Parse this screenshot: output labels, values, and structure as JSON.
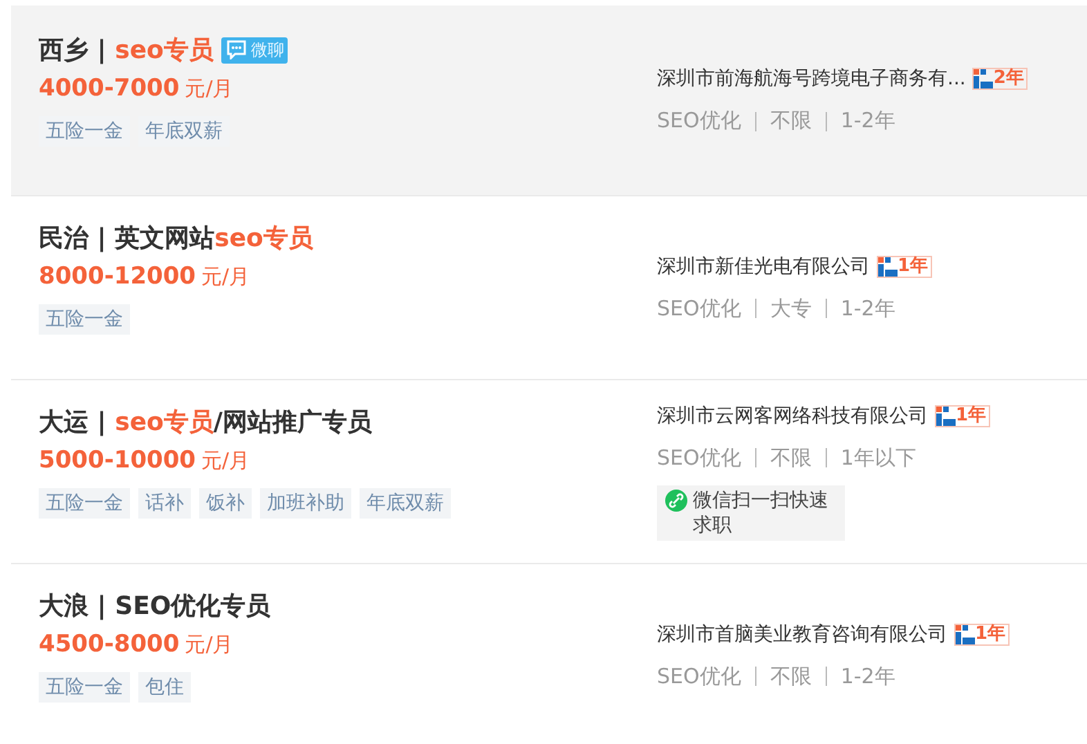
{
  "jobs": [
    {
      "selected": true,
      "title": [
        {
          "text": "西乡 | ",
          "highlight": false
        },
        {
          "text": "seo专员",
          "highlight": true
        }
      ],
      "chat_badge": "微聊",
      "salary": "4000-7000",
      "salary_unit": "元/月",
      "tags": [
        "五险一金",
        "年底双薪"
      ],
      "company": "深圳市前海航海号跨境电子商务有...",
      "member_years": "2年",
      "meta": [
        "SEO优化",
        "不限",
        "1-2年"
      ]
    },
    {
      "selected": false,
      "title": [
        {
          "text": "民治 | 英文网站",
          "highlight": false
        },
        {
          "text": "seo专员",
          "highlight": true
        }
      ],
      "salary": "8000-12000",
      "salary_unit": "元/月",
      "tags": [
        "五险一金"
      ],
      "company": "深圳市新佳光电有限公司",
      "member_years": "1年",
      "meta": [
        "SEO优化",
        "大专",
        "1-2年"
      ]
    },
    {
      "selected": false,
      "title": [
        {
          "text": "大运 | ",
          "highlight": false
        },
        {
          "text": "seo专员",
          "highlight": true
        },
        {
          "text": "/网站推广专员",
          "highlight": false
        }
      ],
      "salary": "5000-10000",
      "salary_unit": "元/月",
      "tags": [
        "五险一金",
        "话补",
        "饭补",
        "加班补助",
        "年底双薪"
      ],
      "company": "深圳市云网客网络科技有限公司",
      "member_years": "1年",
      "meta": [
        "SEO优化",
        "不限",
        "1年以下"
      ],
      "wechat_apply": "微信扫一扫快速求职"
    },
    {
      "selected": false,
      "title": [
        {
          "text": "大浪 | SEO优化专员",
          "highlight": false
        }
      ],
      "salary": "4500-8000",
      "salary_unit": "元/月",
      "tags": [
        "五险一金",
        "包住"
      ],
      "company": "深圳市首脑美业教育咨询有限公司",
      "member_years": "1年",
      "meta": [
        "SEO优化",
        "不限",
        "1-2年"
      ]
    }
  ]
}
